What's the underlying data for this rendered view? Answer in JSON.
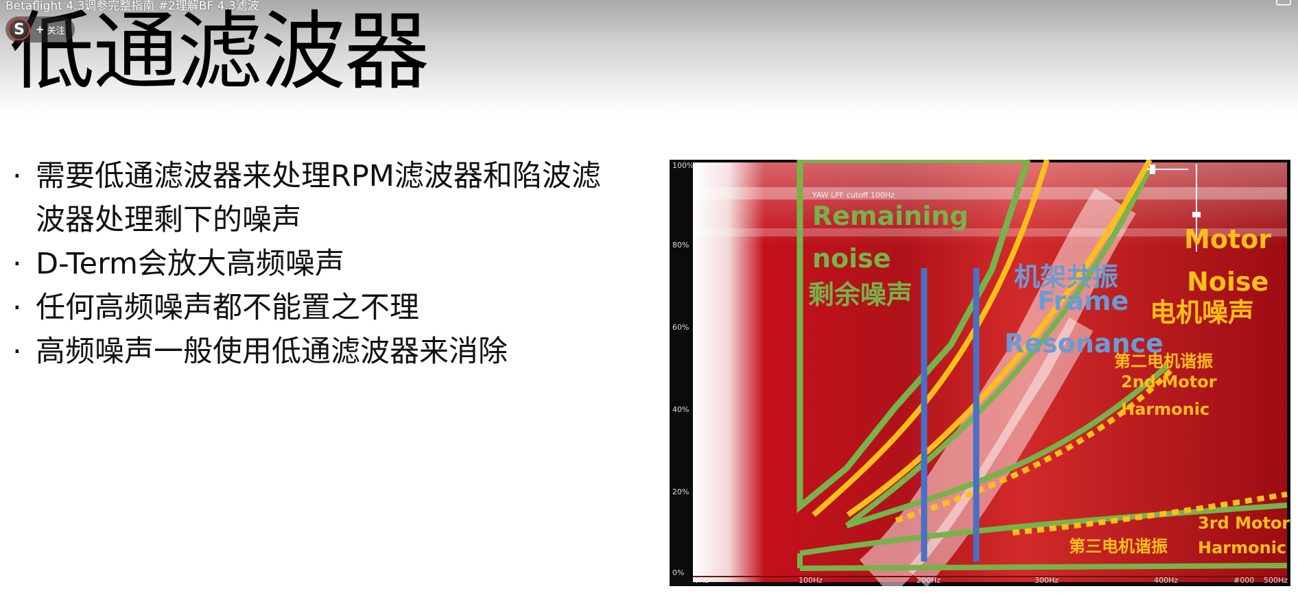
{
  "video": {
    "title": "Betaflight 4.3调参完整指南 #2理解BF 4.3滤波",
    "follow_label": "关注",
    "avatar_letter": "S"
  },
  "slide": {
    "title": "低通滤波器",
    "bullets": [
      "需要低通滤波器来处理RPM滤波器和陷波滤波器处理剩下的噪声",
      "D-Term会放大高频噪声",
      "任何高频噪声都不能置之不理",
      "高频噪声一般使用低通滤波器来消除"
    ]
  },
  "spectrogram": {
    "lpf_label": "YAW LPF cutoff 100Hz",
    "y_ticks": [
      "100%",
      "80%",
      "60%",
      "40%",
      "20%",
      "0%"
    ],
    "x_ticks": [
      "0Hz",
      "100Hz",
      "200Hz",
      "300Hz",
      "400Hz",
      "500Hz"
    ],
    "corner_text": "#000",
    "annotations": {
      "remaining_en": "Remaining",
      "remaining_en2": "noise",
      "remaining_cn": "剩余噪声",
      "frame_cn": "机架共振",
      "frame_en": "Frame",
      "frame_en2": "Resonance",
      "motor_en": "Motor",
      "motor_en2": "Noise",
      "motor_cn": "电机噪声",
      "second_cn": "第二电机谐振",
      "second_en": "2nd Motor",
      "second_en2": "Harmonic",
      "third_cn": "第三电机谐振",
      "third_en": "3rd Motor",
      "third_en2": "Harmonic"
    },
    "colors": {
      "green": "#77b34a",
      "orange": "#ffbf1a",
      "blue": "#4a6fc4",
      "heat": "#c4101a"
    }
  }
}
